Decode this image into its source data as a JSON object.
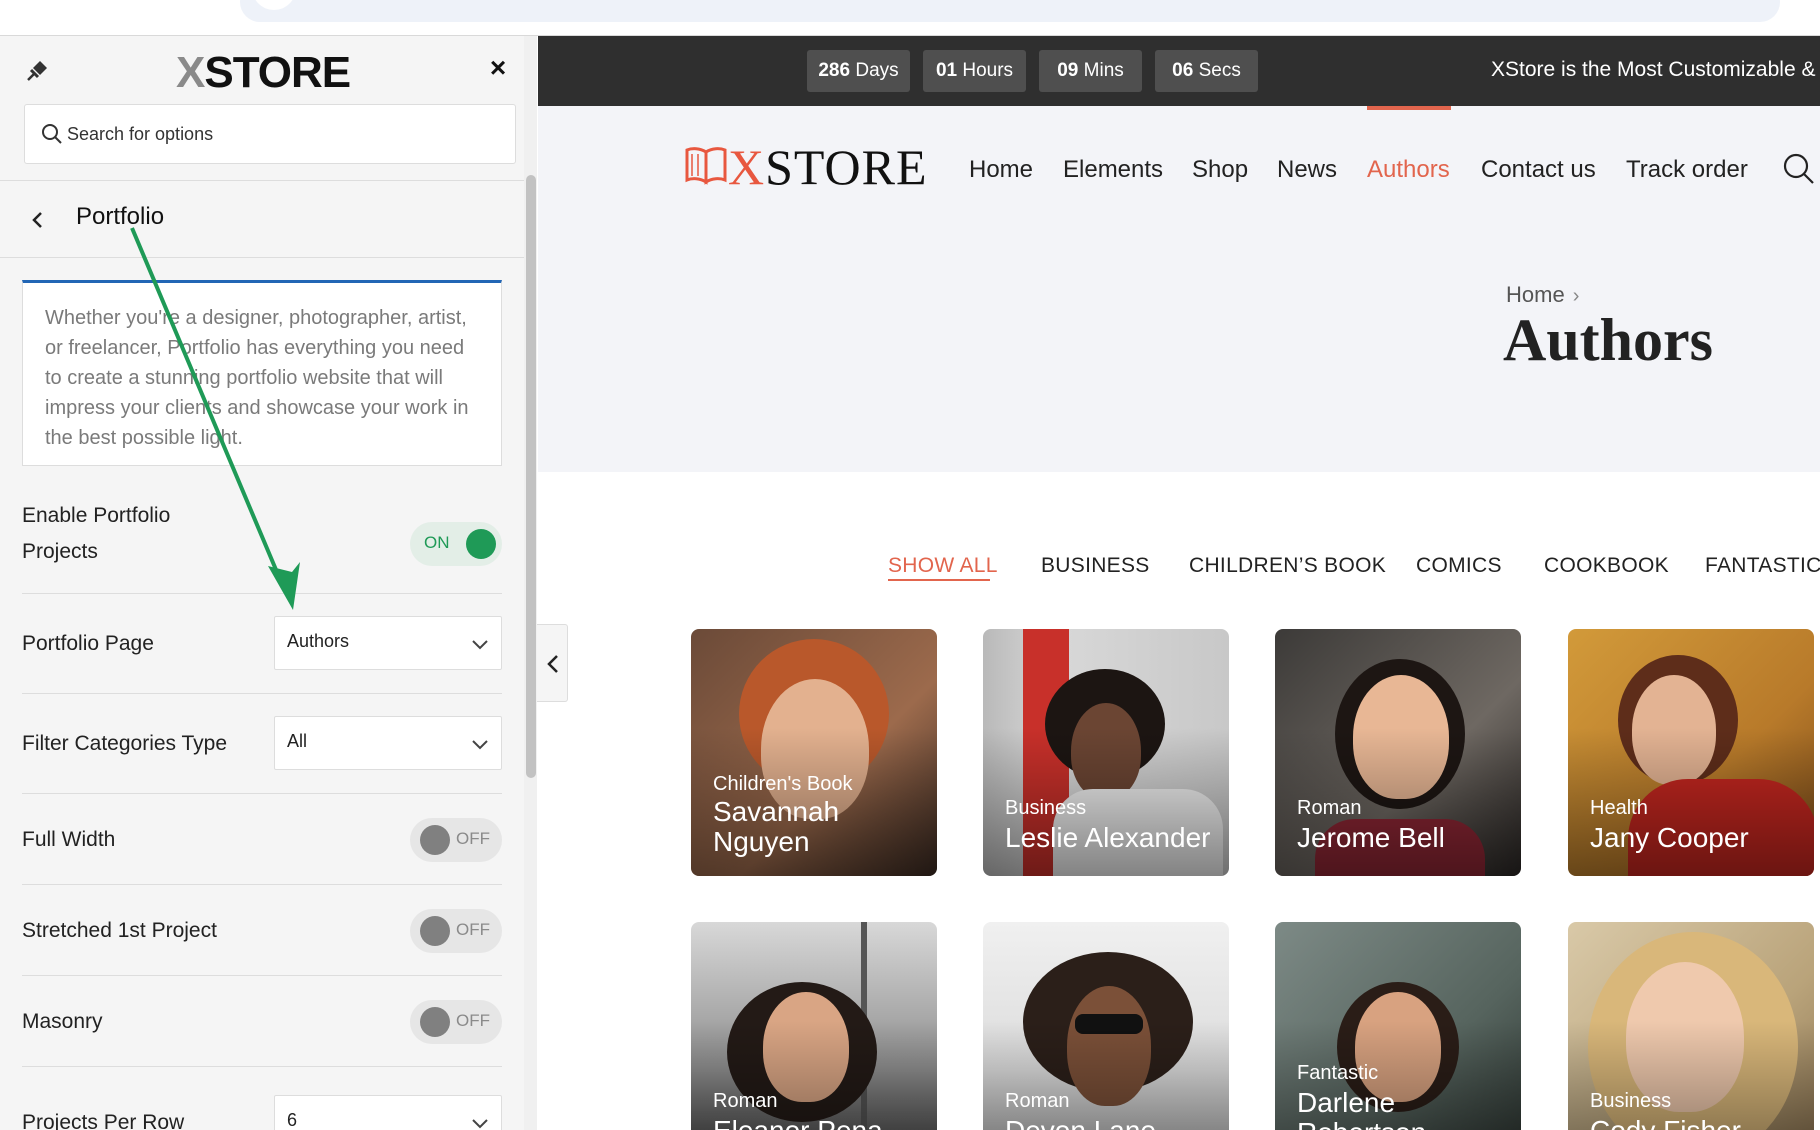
{
  "sidebar": {
    "brand": {
      "x": "X",
      "rest": "STORE"
    },
    "search_placeholder": "Search for options",
    "section_title": "Portfolio",
    "description": "Whether you're a designer, photographer, artist, or freelancer, Portfolio has everything you need to create a stunning portfolio website that will impress your clients and showcase your work in the best possible light.",
    "enable_portfolio": {
      "label_line1": "Enable Portfolio",
      "label_line2": "Projects",
      "state": "ON"
    },
    "portfolio_page": {
      "label": "Portfolio Page",
      "value": "Authors"
    },
    "filter_type": {
      "label": "Filter Categories Type",
      "value": "All"
    },
    "full_width": {
      "label": "Full Width",
      "state": "OFF"
    },
    "stretched": {
      "label": "Stretched 1st Project",
      "state": "OFF"
    },
    "masonry": {
      "label": "Masonry",
      "state": "OFF"
    },
    "per_row": {
      "label": "Projects Per Row",
      "value": "6"
    }
  },
  "countdown": {
    "days": {
      "num": "286",
      "unit": "Days"
    },
    "hours": {
      "num": "01",
      "unit": "Hours"
    },
    "mins": {
      "num": "09",
      "unit": "Mins"
    },
    "secs": {
      "num": "06",
      "unit": "Secs"
    },
    "promo": "XStore is the Most Customizable &"
  },
  "site": {
    "logo": {
      "x": "X",
      "rest": "STORE"
    },
    "nav": [
      "Home",
      "Elements",
      "Shop",
      "News",
      "Authors",
      "Contact us",
      "Track order"
    ],
    "breadcrumb": "Home",
    "page_title": "Authors",
    "filters": [
      "SHOW ALL",
      "BUSINESS",
      "CHILDREN’S BOOK",
      "COMICS",
      "COOKBOOK",
      "FANTASTIC"
    ],
    "cards": [
      {
        "category": "Children's Book",
        "name": "Savannah Nguyen"
      },
      {
        "category": "Business",
        "name": "Leslie Alexander"
      },
      {
        "category": "Roman",
        "name": "Jerome Bell"
      },
      {
        "category": "Health",
        "name": "Jany Cooper"
      },
      {
        "category": "Roman",
        "name": "Eleanor Pena"
      },
      {
        "category": "Roman",
        "name": "Devon Lane"
      },
      {
        "category": "Fantastic",
        "name": "Darlene Robertson"
      },
      {
        "category": "Business",
        "name": "Cody Fisher"
      }
    ]
  },
  "colors": {
    "accent": "#e2654d",
    "toggle_on": "#1f9a57",
    "desc_border": "#2266b5",
    "arrow": "#1f9a57"
  }
}
